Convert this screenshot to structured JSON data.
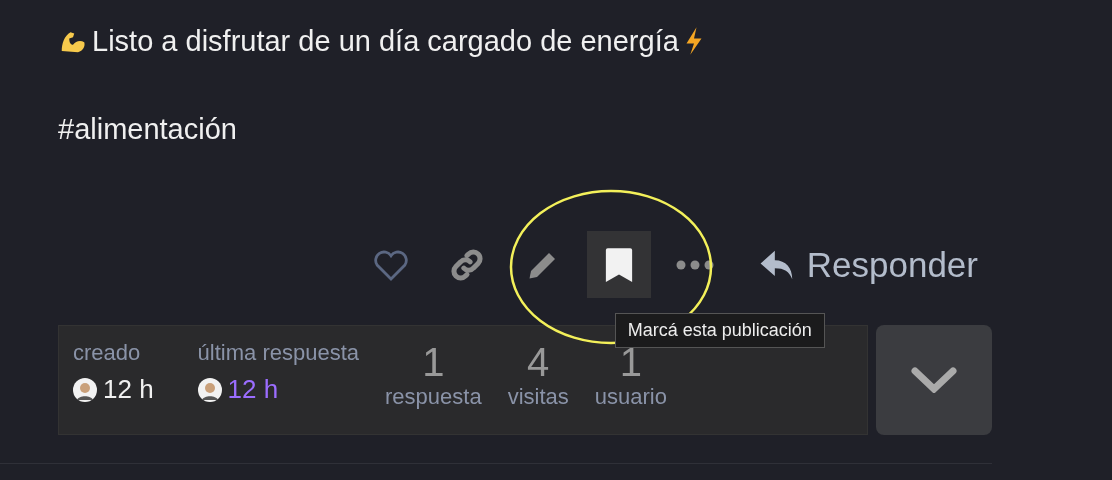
{
  "post": {
    "paragraphs": [
      "Listo a disfrutar de un día cargado de energía",
      "#alimentación"
    ]
  },
  "actions": [
    {
      "kind": "like",
      "highlighted": false
    },
    {
      "kind": "link",
      "highlighted": false
    },
    {
      "kind": "edit",
      "highlighted": false
    },
    {
      "kind": "bookmark",
      "highlighted": true,
      "tooltip": "Marcá esta publicación"
    },
    {
      "kind": "more",
      "highlighted": false
    }
  ],
  "reply_button": {
    "label": "Responder"
  },
  "topic_map": {
    "created": {
      "label": "creado",
      "time": "12 h"
    },
    "last_reply": {
      "label": "última respuesta",
      "time": "12 h"
    },
    "stats": [
      {
        "value": "1",
        "label": "respuesta"
      },
      {
        "value": "4",
        "label": "visitas"
      },
      {
        "value": "1",
        "label": "usuario"
      }
    ]
  }
}
